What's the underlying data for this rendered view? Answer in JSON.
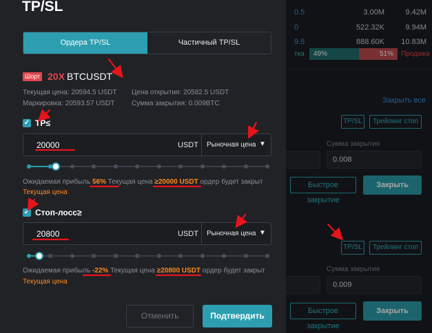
{
  "modal": {
    "title": "TP/SL",
    "tabs": [
      {
        "label": "Ордера TP/SL",
        "active": true
      },
      {
        "label": "Частичный TP/SL",
        "active": false
      }
    ],
    "position": {
      "side": "Шорт",
      "leverage": "20X",
      "symbol": "BTCUSDT"
    },
    "info": {
      "current_price": "Текущая цена: 20594.5 USDT",
      "mark_price": "Маркировка: 20593.57 USDT",
      "open_price": "Цена открытия: 20582.5 USDT",
      "close_amount": "Сумма закрытия: 0.009BTC"
    },
    "tp": {
      "label": "TP≤",
      "checked": true,
      "value": "20000",
      "unit": "USDT",
      "order_type": "Рыночная цена",
      "slider_level_percent": 12,
      "expect_prefix": "Ожидаемая прибыль",
      "expect_pct": "56%",
      "expect_mid": "Текущая цена",
      "expect_price": "≥20000 USDT",
      "expect_suffix": "ордер будет закрыт",
      "expect_line2": "Текущая цена"
    },
    "sl": {
      "label": "Стоп-лосс≥",
      "checked": true,
      "value": "20800",
      "unit": "USDT",
      "order_type": "Рыночная цена",
      "slider_level_percent": 5,
      "expect_prefix": "Ожидаемая прибыль",
      "expect_pct": "-22%",
      "expect_mid": "Текущая цена",
      "expect_price": "≥20800 USDT",
      "expect_suffix": "ордер будет закрыт",
      "expect_line2": "Текущая цена"
    },
    "buttons": {
      "cancel": "Отменить",
      "confirm": "Подтвердить"
    }
  },
  "background": {
    "rows": [
      {
        "price": "0.5",
        "v1": "3.00M",
        "v2": "9.42M"
      },
      {
        "price": "0",
        "v1": "522.32K",
        "v2": "9.94M"
      },
      {
        "price": "9.5",
        "v1": "888.60K",
        "v2": "10.83M"
      }
    ],
    "ratio": {
      "buy_label": "тка",
      "buy": "49%",
      "sell": "51%",
      "sell_label": "Продажа"
    },
    "close_all": "Закрыть все",
    "pos1": {
      "tpsl": "TP/SL",
      "trailing": "Трейлинг стоп",
      "close_amount_label": "Сумма закрытия",
      "close_amount_value": "0.008",
      "quick_close": "Быстрое закрытие",
      "close": "Закрыть"
    },
    "pos2": {
      "tpsl": "TP/SL",
      "trailing": "Трейлинг стоп",
      "close_amount_label": "Сумма закрытия",
      "close_amount_value": "0.009",
      "quick_close": "Быстрое закрытие",
      "close": "Закрыть"
    }
  },
  "colors": {
    "accent": "#2c9eb0",
    "short_red": "#e0474f",
    "highlight_orange": "#ff8a1f",
    "annotation_red": "#e8141c"
  }
}
